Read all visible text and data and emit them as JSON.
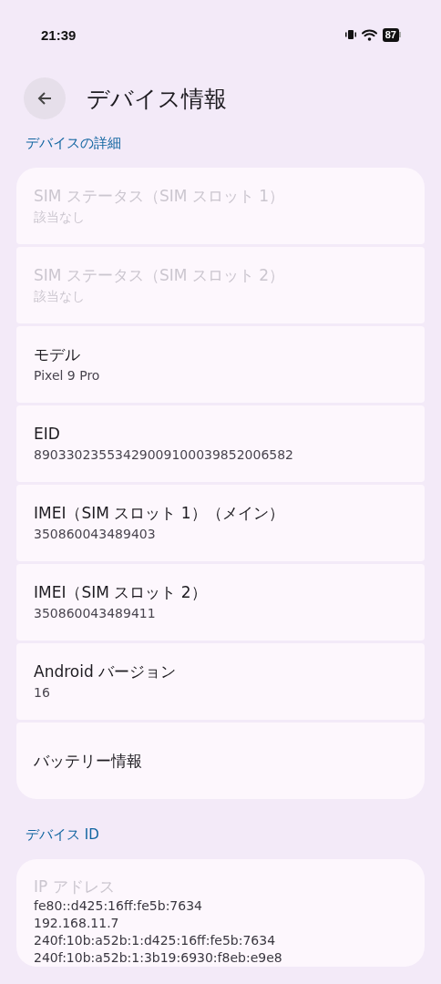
{
  "status_bar": {
    "time": "21:39",
    "battery": "87"
  },
  "header": {
    "title": "デバイス情報"
  },
  "sections": [
    {
      "title": "デバイスの詳細",
      "items": [
        {
          "title": "SIM ステータス（SIM スロット 1）",
          "summary": "該当なし",
          "disabled": true
        },
        {
          "title": "SIM ステータス（SIM スロット 2）",
          "summary": "該当なし",
          "disabled": true
        },
        {
          "title": "モデル",
          "summary": "Pixel 9 Pro",
          "disabled": false
        },
        {
          "title": "EID",
          "summary": "89033023553429009100039852006582",
          "disabled": false
        },
        {
          "title": "IMEI（SIM スロット 1）（メイン）",
          "summary": "350860043489403",
          "disabled": false
        },
        {
          "title": "IMEI（SIM スロット 2）",
          "summary": "350860043489411",
          "disabled": false
        },
        {
          "title": "Android バージョン",
          "summary": "16",
          "disabled": false
        },
        {
          "title": "バッテリー情報",
          "disabled": false
        }
      ]
    },
    {
      "title": "デバイス ID",
      "items": [
        {
          "title": "IP アドレス",
          "disabled": true,
          "lines": [
            "fe80::d425:16ff:fe5b:7634",
            "192.168.11.7",
            "240f:10b:a52b:1:d425:16ff:fe5b:7634",
            "240f:10b:a52b:1:3b19:6930:f8eb:e9e8"
          ]
        }
      ]
    }
  ]
}
